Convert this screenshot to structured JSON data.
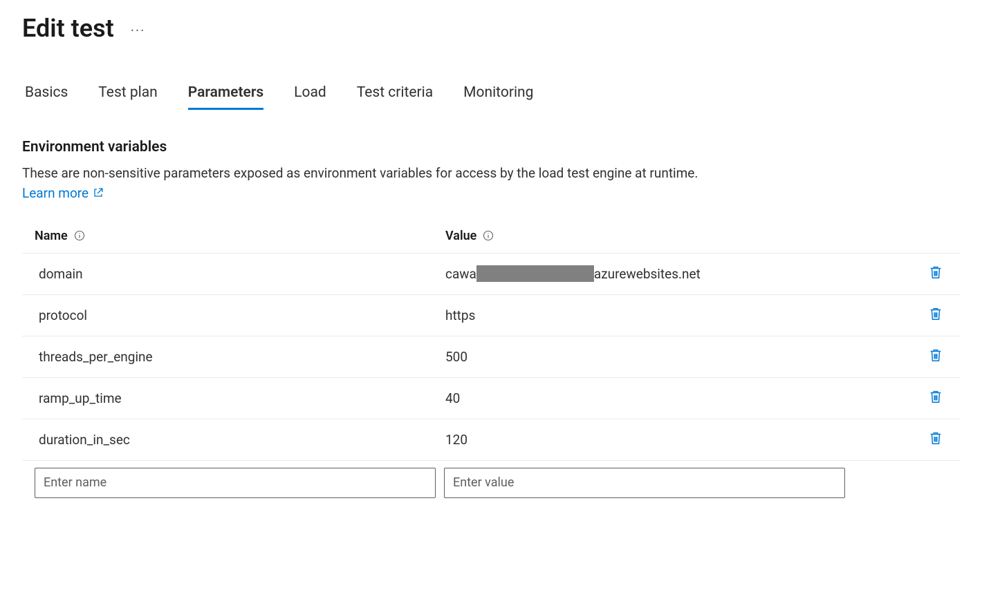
{
  "header": {
    "title": "Edit test"
  },
  "tabs": [
    {
      "label": "Basics",
      "active": false
    },
    {
      "label": "Test plan",
      "active": false
    },
    {
      "label": "Parameters",
      "active": true
    },
    {
      "label": "Load",
      "active": false
    },
    {
      "label": "Test criteria",
      "active": false
    },
    {
      "label": "Monitoring",
      "active": false
    }
  ],
  "section": {
    "title": "Environment variables",
    "description": "These are non-sensitive parameters exposed as environment variables for access by the load test engine at runtime.",
    "learnMore": "Learn more"
  },
  "table": {
    "headers": {
      "name": "Name",
      "value": "Value"
    },
    "rows": [
      {
        "name": "domain",
        "valuePrefix": "cawa",
        "valueSuffix": "azurewebsites.net",
        "redacted": true
      },
      {
        "name": "protocol",
        "value": "https"
      },
      {
        "name": "threads_per_engine",
        "value": "500"
      },
      {
        "name": "ramp_up_time",
        "value": "40"
      },
      {
        "name": "duration_in_sec",
        "value": "120"
      }
    ],
    "inputs": {
      "namePlaceholder": "Enter name",
      "valuePlaceholder": "Enter value"
    }
  }
}
